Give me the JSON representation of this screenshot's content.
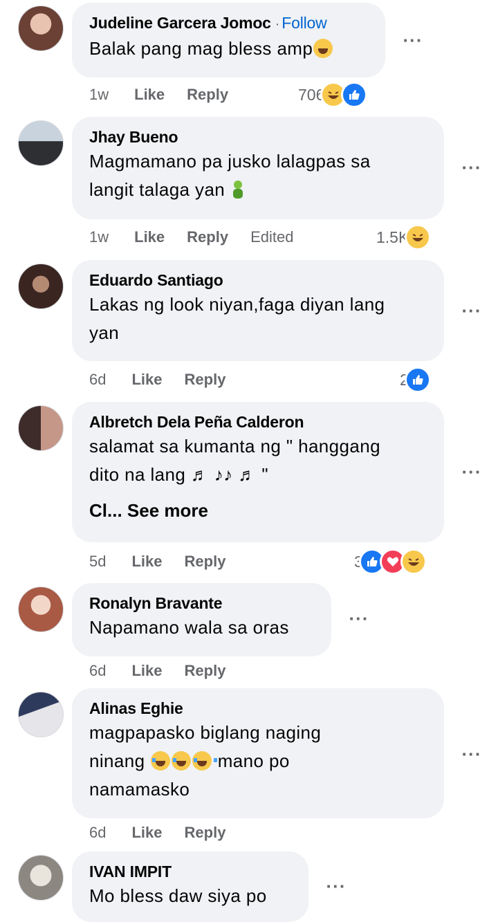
{
  "comments": [
    {
      "author": "Judeline Garcera Jomoc",
      "follow_label": "Follow",
      "follow_separator": "·",
      "lines": [
        "Balak pang mag bless amp"
      ],
      "time": "1w",
      "like_label": "Like",
      "reply_label": "Reply",
      "reaction_count": "706",
      "reactions": [
        "haha-icon",
        "like-icon"
      ],
      "avatar_color": "#c98a7a"
    },
    {
      "author": "Jhay Bueno",
      "lines": [
        "Magmamano pa jusko lalagpas sa",
        "langit talaga yan"
      ],
      "time": "1w",
      "like_label": "Like",
      "reply_label": "Reply",
      "edited_label": "Edited",
      "reaction_count": "1.5K",
      "reactions": [
        "haha-icon"
      ],
      "avatar_color": "#8a9bb0"
    },
    {
      "author": "Eduardo Santiago",
      "lines": [
        "Lakas ng look niyan,faga diyan lang",
        "yan"
      ],
      "time": "6d",
      "like_label": "Like",
      "reply_label": "Reply",
      "reaction_count": "2",
      "reactions": [
        "like-icon"
      ],
      "avatar_color": "#6d5a52"
    },
    {
      "author": "Albretch Dela Peña Calderon",
      "lines": [
        "salamat sa kumanta ng \" hanggang",
        "dito na lang ♬ ♪♪ ♬ \""
      ],
      "see_more": "Cl... See more",
      "time": "5d",
      "like_label": "Like",
      "reply_label": "Reply",
      "reaction_count": "3",
      "reactions": [
        "like-icon",
        "love-icon",
        "haha-icon"
      ],
      "avatar_color": "#4e3b36"
    },
    {
      "author": "Ronalyn Bravante",
      "lines": [
        "Napamano wala sa oras"
      ],
      "time": "6d",
      "like_label": "Like",
      "reply_label": "Reply",
      "avatar_color": "#c7a49a"
    },
    {
      "author": "Alinas Eghie",
      "lines": [
        "magpapasko biglang naging",
        "ninang",
        "mano po",
        "namamasko"
      ],
      "time": "6d",
      "like_label": "Like",
      "reply_label": "Reply",
      "avatar_color": "#9aa3b8"
    },
    {
      "author": "IVAN IMPIT",
      "lines": [
        "Mo bless daw siya po"
      ],
      "avatar_color": "#b9b5ad"
    }
  ],
  "more_label": "···"
}
